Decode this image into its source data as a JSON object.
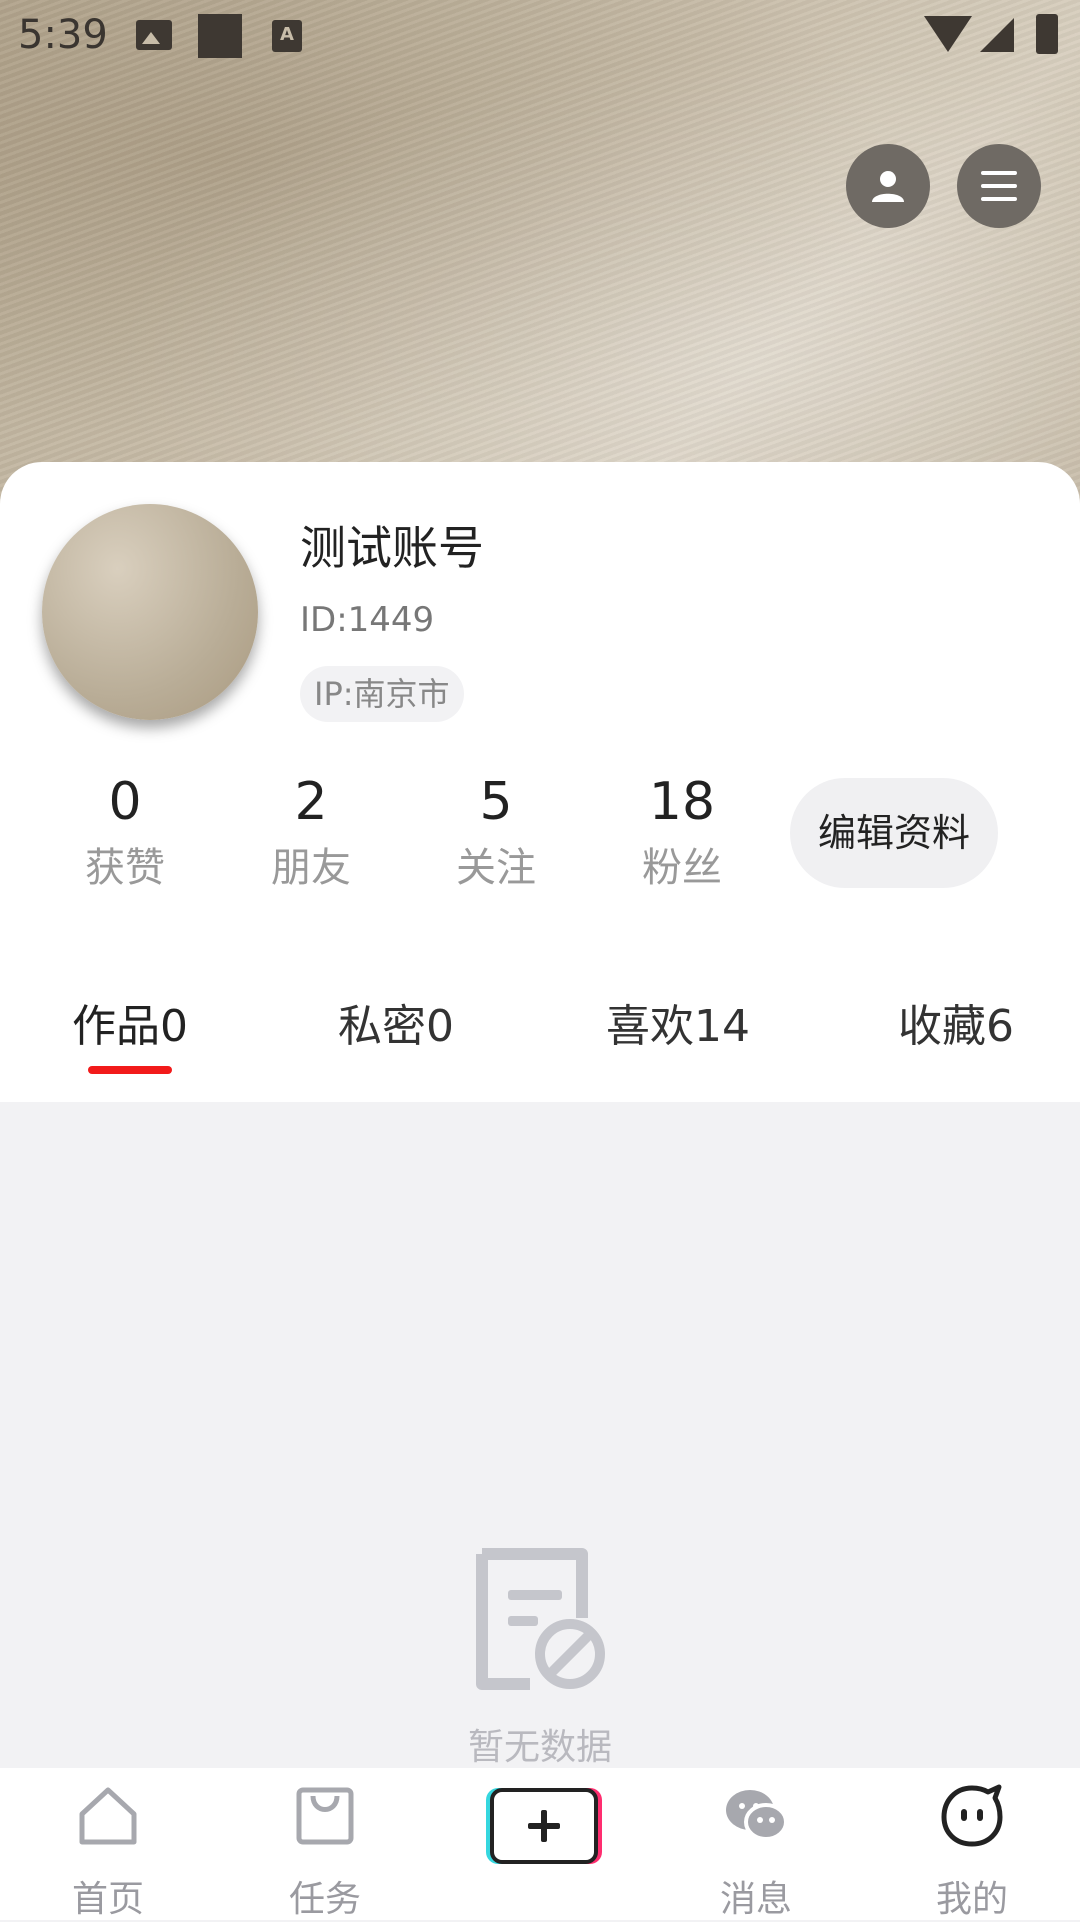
{
  "status_bar": {
    "time": "5:39"
  },
  "profile": {
    "name": "测试账号",
    "id_text": "ID:1449",
    "ip_text": "IP:南京市"
  },
  "stats": [
    {
      "value": "0",
      "label": "获赞"
    },
    {
      "value": "2",
      "label": "朋友"
    },
    {
      "value": "5",
      "label": "关注"
    },
    {
      "value": "18",
      "label": "粉丝"
    }
  ],
  "edit_button": "编辑资料",
  "tabs": [
    {
      "label": "作品0",
      "active": true
    },
    {
      "label": "私密0",
      "active": false
    },
    {
      "label": "喜欢14",
      "active": false
    },
    {
      "label": "收藏6",
      "active": false
    }
  ],
  "empty_state": {
    "text": "暂无数据",
    "icon": "no-data-document-icon"
  },
  "bottom_nav": [
    {
      "label": "首页",
      "icon": "home-icon"
    },
    {
      "label": "任务",
      "icon": "bag-icon"
    },
    {
      "label": "",
      "icon": "plus-icon"
    },
    {
      "label": "消息",
      "icon": "chat-icon"
    },
    {
      "label": "我的",
      "icon": "smiley-face-icon",
      "active": true
    }
  ],
  "colors": {
    "tab_indicator": "#f21a1a",
    "empty_gray": "#b9b9bf",
    "nav_gray": "#9a9aa0"
  }
}
